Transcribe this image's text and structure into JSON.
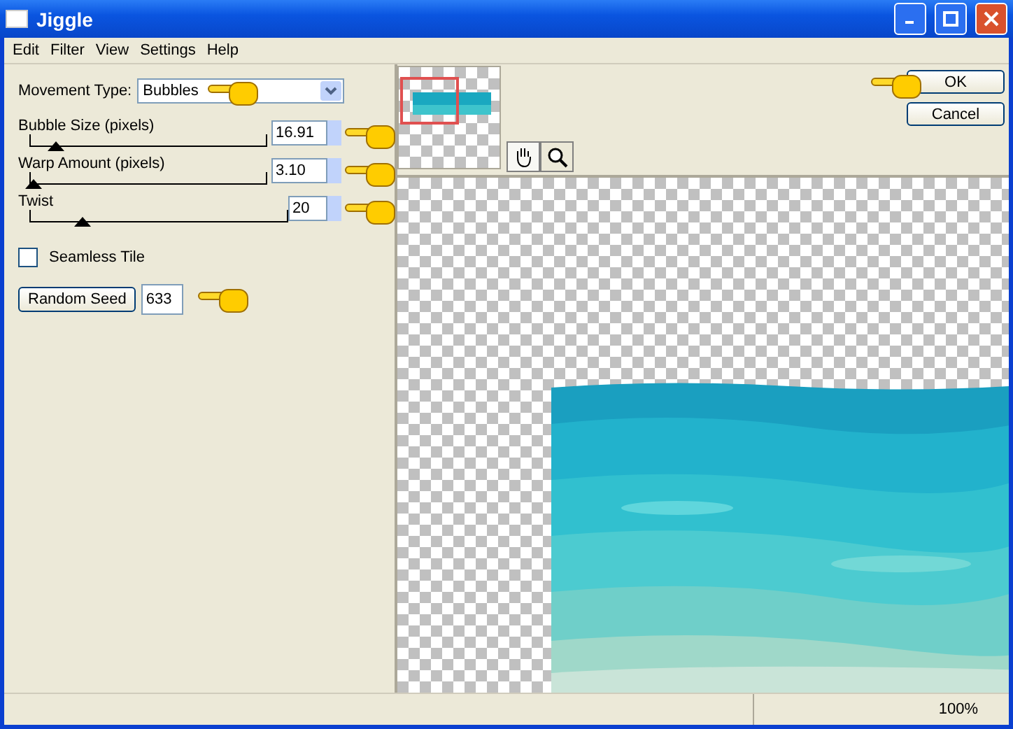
{
  "window": {
    "title": "Jiggle"
  },
  "menu": [
    "Edit",
    "Filter",
    "View",
    "Settings",
    "Help"
  ],
  "movement_type": {
    "label": "Movement Type:",
    "value": "Bubbles"
  },
  "sliders": [
    {
      "label": "Bubble Size (pixels)",
      "value": "16.91",
      "level": 0.11
    },
    {
      "label": "Warp Amount (pixels)",
      "value": "3.10",
      "level": 0.01
    },
    {
      "label": "Twist",
      "value": "20",
      "level": 0.2
    }
  ],
  "seamless_tile": {
    "label": "Seamless Tile",
    "checked": false
  },
  "random_seed": {
    "button": "Random Seed",
    "value": "633"
  },
  "buttons": [
    "OK",
    "Cancel"
  ],
  "tools": [
    {
      "kind": "hand",
      "selected": true
    },
    {
      "kind": "zoom",
      "selected": false
    }
  ],
  "status_bar": {
    "zoom": "100%"
  }
}
